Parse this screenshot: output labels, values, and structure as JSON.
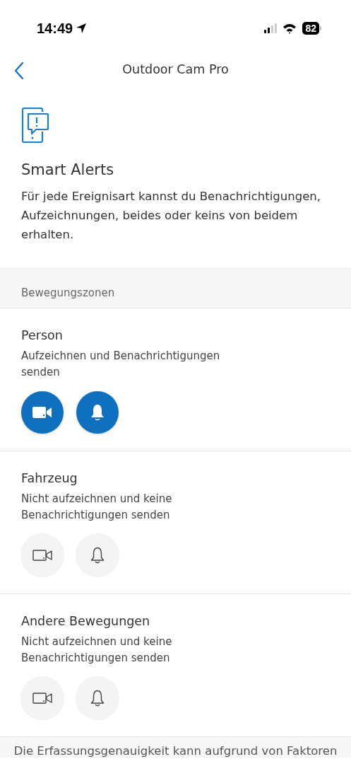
{
  "status_bar": {
    "time": "14:49",
    "battery": "82"
  },
  "nav": {
    "title": "Outdoor Cam Pro"
  },
  "intro": {
    "heading": "Smart Alerts",
    "description": "Für jede Ereignisart kannst du Benachrichtigungen, Aufzeichnungen, beides oder keins von beidem erhalten."
  },
  "section": {
    "title": "Bewegungszonen"
  },
  "zones": [
    {
      "name": "Person",
      "summary": "Aufzeichnen und Benachrichtigungen senden",
      "record": true,
      "notify": true
    },
    {
      "name": "Fahrzeug",
      "summary": "Nicht aufzeichnen und keine Benachrichtigungen senden",
      "record": false,
      "notify": false
    },
    {
      "name": "Andere Bewegungen",
      "summary": "Nicht aufzeichnen und keine Benachrichtigungen senden",
      "record": false,
      "notify": false
    }
  ],
  "footer": {
    "text": "Die Erfassungsgenauigkeit kann aufgrund von Faktoren"
  }
}
